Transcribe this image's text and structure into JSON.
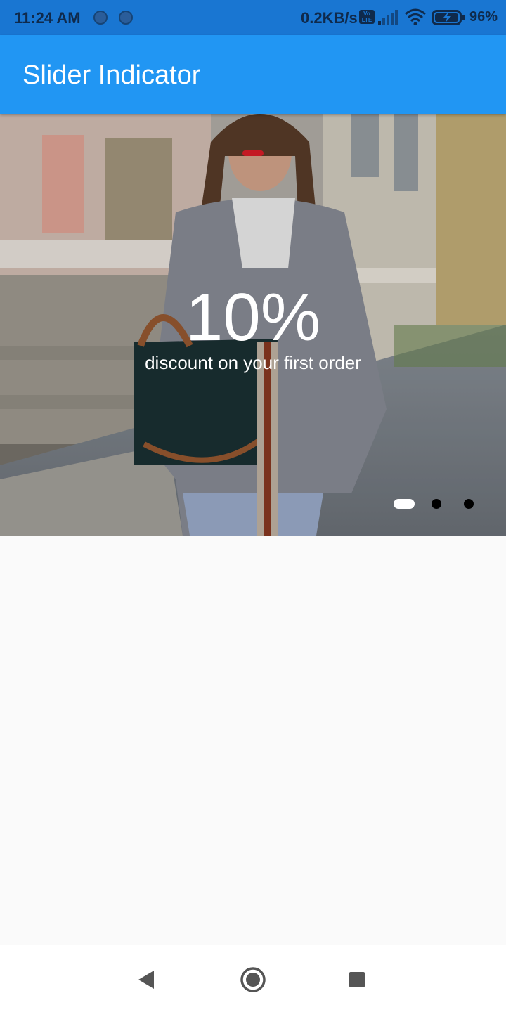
{
  "status_bar": {
    "time": "11:24 AM",
    "network_speed": "0.2KB/s",
    "lte_badge": "Vo LTE",
    "battery_percent": "96%",
    "icons": [
      "notification-dot-icon",
      "notification-dot-icon",
      "volte-icon",
      "signal-icon",
      "wifi-icon",
      "battery-charging-icon"
    ]
  },
  "app_bar": {
    "title": "Slider Indicator",
    "color": "#2196f3"
  },
  "slider": {
    "headline": "10%",
    "subline": "discount on your first order",
    "image": "woman-with-handbag-photo",
    "slide_count": 3,
    "active_index": 0
  },
  "nav_bar": {
    "icons": [
      "back-icon",
      "home-icon",
      "recents-icon"
    ]
  }
}
